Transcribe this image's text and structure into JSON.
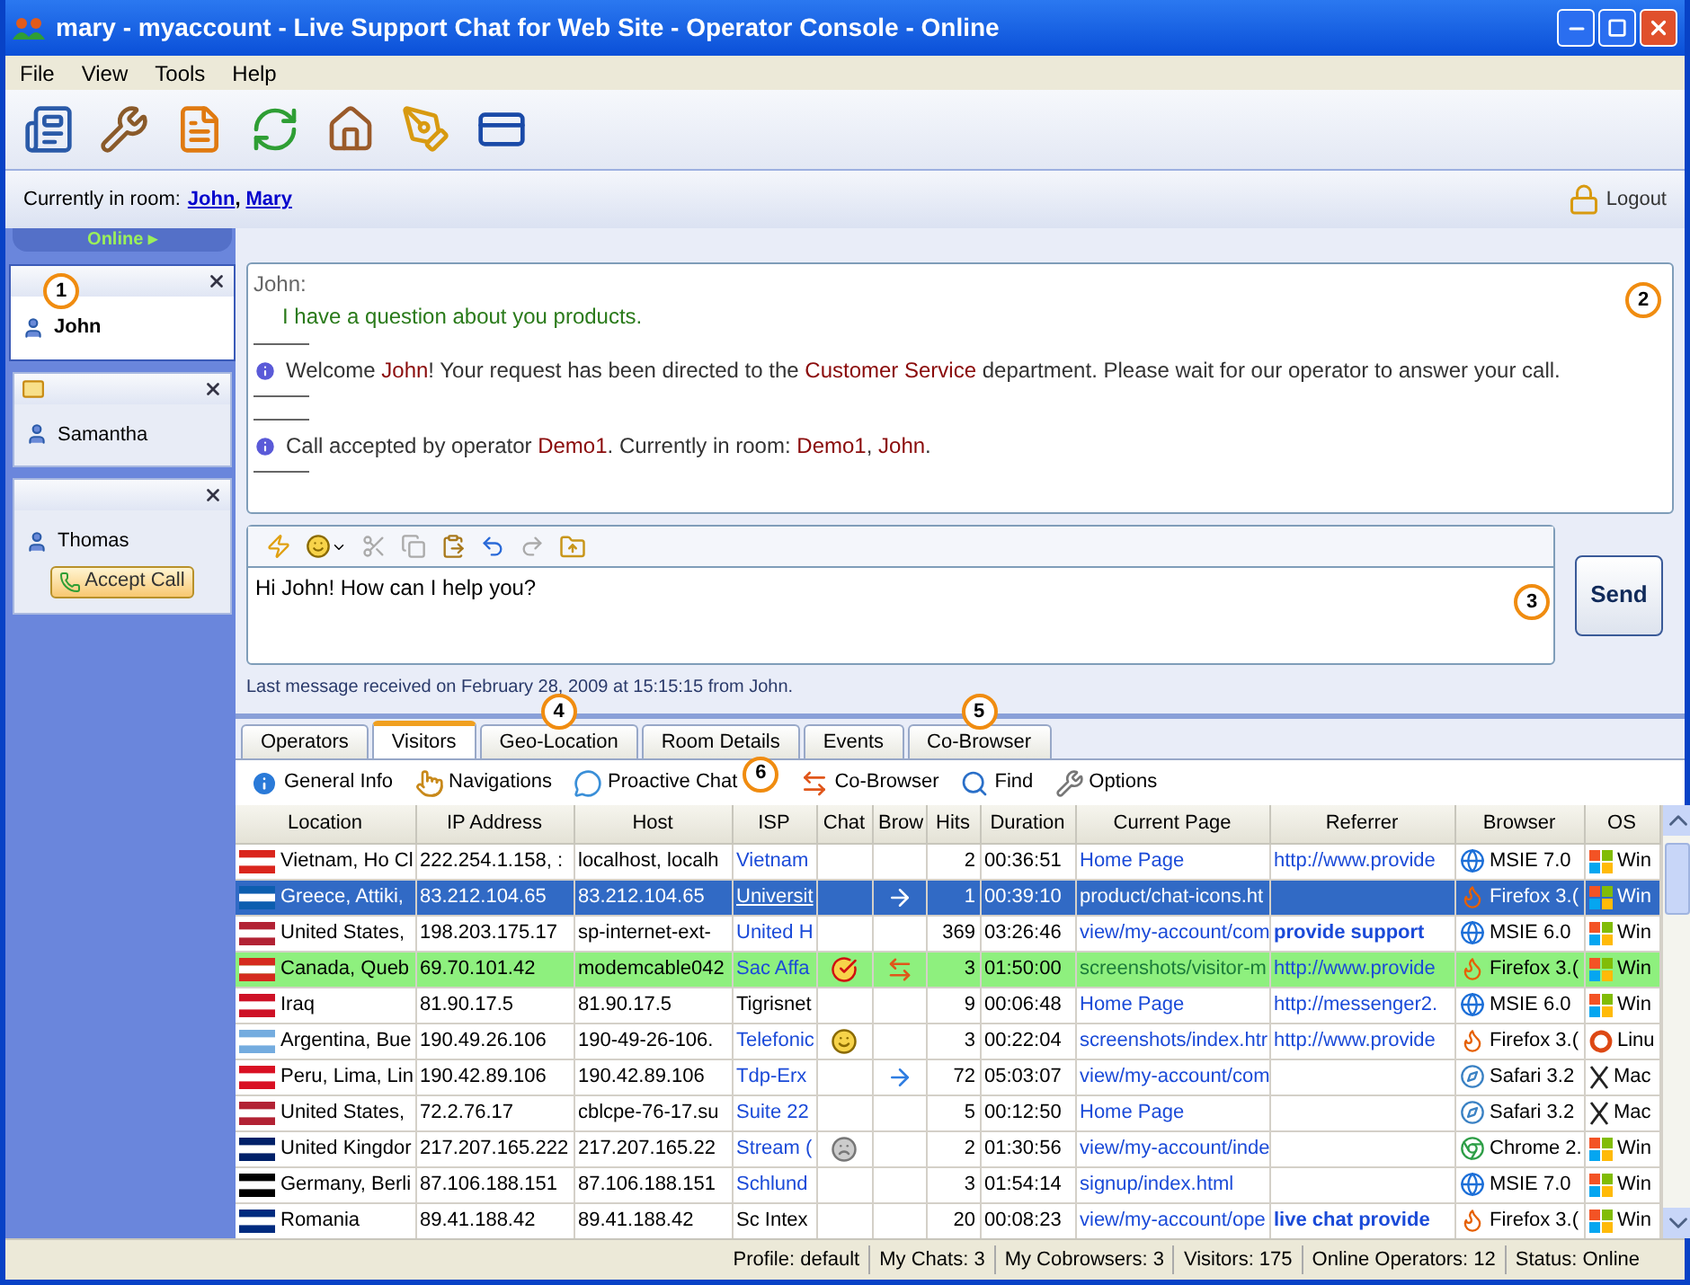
{
  "window": {
    "title": "mary - myaccount - Live Support Chat for Web Site - Operator Console - Online"
  },
  "menu": [
    "File",
    "View",
    "Tools",
    "Help"
  ],
  "room": {
    "label": "Currently in room:",
    "members": [
      "John",
      "Mary"
    ],
    "separator": ",",
    "logout": "Logout"
  },
  "status_tab": "Online ▸",
  "sessions": [
    {
      "name": "John",
      "selected": true,
      "unread": false,
      "marker": "1"
    },
    {
      "name": "Samantha",
      "selected": false,
      "unread": true
    },
    {
      "name": "Thomas",
      "selected": false,
      "unread": false,
      "action": "Accept Call"
    }
  ],
  "transcript": {
    "marker": "2",
    "messages": [
      {
        "kind": "chat",
        "author": "John:",
        "text": "I have a question about you products."
      },
      {
        "kind": "info",
        "parts": [
          {
            "text": "Welcome ",
            "highlight": false
          },
          {
            "text": "John",
            "highlight": true
          },
          {
            "text": "! Your request has been directed to the ",
            "highlight": false
          },
          {
            "text": "Customer Service",
            "highlight": true
          },
          {
            "text": " department.  Please wait for our operator to answer your call.",
            "highlight": false
          }
        ]
      },
      {
        "kind": "info",
        "parts": [
          {
            "text": "Call accepted by operator ",
            "highlight": false
          },
          {
            "text": "Demo1",
            "highlight": true
          },
          {
            "text": ". Currently in room: ",
            "highlight": false
          },
          {
            "text": "Demo1",
            "highlight": true
          },
          {
            "text": ", ",
            "highlight": false
          },
          {
            "text": "John",
            "highlight": true
          },
          {
            "text": ".",
            "highlight": false
          }
        ]
      }
    ]
  },
  "composer": {
    "value": "Hi John! How can I help you?",
    "marker": "3",
    "send": "Send"
  },
  "last_message": "Last message received on February 28, 2009 at 15:15:15 from John.",
  "tabs": [
    {
      "label": "Operators",
      "selected": false
    },
    {
      "label": "Visitors",
      "selected": true
    },
    {
      "label": "Geo-Location",
      "selected": false,
      "marker": "4"
    },
    {
      "label": "Room Details",
      "selected": false
    },
    {
      "label": "Events",
      "selected": false
    },
    {
      "label": "Co-Browser",
      "selected": false,
      "marker": "5"
    }
  ],
  "visitor_toolbar": [
    {
      "kind": "info",
      "label": "General Info"
    },
    {
      "kind": "hand",
      "label": "Navigations"
    },
    {
      "kind": "bubble",
      "label": "Proactive Chat",
      "marker": "6"
    },
    {
      "kind": "cobrowse",
      "label": "Co-Browser"
    },
    {
      "kind": "search",
      "label": "Find"
    },
    {
      "kind": "tools",
      "label": "Options"
    }
  ],
  "table": {
    "columns": [
      "Location",
      "IP Address",
      "Host",
      "ISP",
      "Chat",
      "Brow",
      "Hits",
      "Duration",
      "Current Page",
      "Referrer",
      "Browser",
      "OS"
    ],
    "rows": [
      {
        "selected": false,
        "in_chat": false,
        "color": "#da251d",
        "location": "Vietnam, Ho Cl",
        "ip": "222.254.1.158, :",
        "host": "localhost, localh",
        "isp": {
          "text": "Vietnam",
          "link": true
        },
        "hits": "2",
        "duration": "00:36:51",
        "page": "Home Page",
        "referrer": {
          "text": "http://www.provide",
          "kind": "url"
        },
        "browser": {
          "text": "MSIE 7.0",
          "kind": "ie"
        },
        "os": {
          "text": "Win",
          "kind": "windows"
        }
      },
      {
        "selected": true,
        "in_chat": false,
        "color": "#0d5eaf",
        "location": "Greece, Attiki,",
        "ip": "83.212.104.65",
        "host": "83.212.104.65",
        "isp": {
          "text": "Universit",
          "link": true
        },
        "brow": {
          "kind": "arrow"
        },
        "hits": "1",
        "duration": "00:39:10",
        "page": "product/chat-icons.ht",
        "browser": {
          "text": "Firefox 3.(",
          "kind": "firefox"
        },
        "os": {
          "text": "Win",
          "kind": "windows"
        }
      },
      {
        "selected": false,
        "in_chat": false,
        "color": "#b22234",
        "location": "United States,",
        "ip": "198.203.175.17",
        "host": "sp-internet-ext-",
        "isp": {
          "text": "United H",
          "link": true
        },
        "hits": "369",
        "duration": "03:26:46",
        "page": "view/my-account/com",
        "referrer": {
          "text": "provide support",
          "kind": "keyword"
        },
        "browser": {
          "text": "MSIE 6.0",
          "kind": "ie"
        },
        "os": {
          "text": "Win",
          "kind": "windows"
        }
      },
      {
        "selected": false,
        "in_chat": true,
        "color": "#d52b1e",
        "location": "Canada, Queb",
        "ip": "69.70.101.42",
        "host": "modemcable042",
        "isp": {
          "text": "Sac Affa",
          "link": true
        },
        "chat": {
          "kind": "accepted"
        },
        "brow": {
          "kind": "cobrowse"
        },
        "hits": "3",
        "duration": "01:50:00",
        "page": "screenshots/visitor-m",
        "referrer": {
          "text": "http://www.provide",
          "kind": "url"
        },
        "browser": {
          "text": "Firefox 3.(",
          "kind": "firefox"
        },
        "os": {
          "text": "Win",
          "kind": "windows"
        }
      },
      {
        "selected": false,
        "in_chat": false,
        "color": "#ce1126",
        "location": "Iraq",
        "ip": "81.90.17.5",
        "host": "81.90.17.5",
        "isp": {
          "text": "Tigrisnet",
          "link": false
        },
        "hits": "9",
        "duration": "00:06:48",
        "page": "Home Page",
        "referrer": {
          "text": "http://messenger2.",
          "kind": "url"
        },
        "browser": {
          "text": "MSIE 6.0",
          "kind": "ie"
        },
        "os": {
          "text": "Win",
          "kind": "windows"
        }
      },
      {
        "selected": false,
        "in_chat": false,
        "color": "#74acdf",
        "location": "Argentina, Bue",
        "ip": "190.49.26.106",
        "host": "190-49-26-106.",
        "isp": {
          "text": "Telefonic",
          "link": true
        },
        "chat": {
          "kind": "smiley"
        },
        "hits": "3",
        "duration": "00:22:04",
        "page": "screenshots/index.htr",
        "referrer": {
          "text": "http://www.provide",
          "kind": "url"
        },
        "browser": {
          "text": "Firefox 3.(",
          "kind": "firefox"
        },
        "os": {
          "text": "Linu",
          "kind": "linux"
        }
      },
      {
        "selected": false,
        "in_chat": false,
        "color": "#d91023",
        "location": "Peru, Lima, Lin",
        "ip": "190.42.89.106",
        "host": "190.42.89.106",
        "isp": {
          "text": "Tdp-Erx",
          "link": true
        },
        "brow": {
          "kind": "arrow"
        },
        "hits": "72",
        "duration": "05:03:07",
        "page": "view/my-account/com",
        "browser": {
          "text": "Safari 3.2",
          "kind": "safari"
        },
        "os": {
          "text": "Mac",
          "kind": "mac"
        }
      },
      {
        "selected": false,
        "in_chat": false,
        "color": "#b22234",
        "location": "United States,",
        "ip": "72.2.76.17",
        "host": "cblcpe-76-17.su",
        "isp": {
          "text": "Suite 22",
          "link": true
        },
        "hits": "5",
        "duration": "00:12:50",
        "page": "Home Page",
        "browser": {
          "text": "Safari 3.2",
          "kind": "safari"
        },
        "os": {
          "text": "Mac",
          "kind": "mac"
        }
      },
      {
        "selected": false,
        "in_chat": false,
        "color": "#012169",
        "location": "United Kingdor",
        "ip": "217.207.165.222",
        "host": "217.207.165.22",
        "isp": {
          "text": "Stream (",
          "link": true
        },
        "chat": {
          "kind": "idle"
        },
        "hits": "2",
        "duration": "01:30:56",
        "page": "view/my-account/inde",
        "browser": {
          "text": "Chrome 2.",
          "kind": "chrome"
        },
        "os": {
          "text": "Win",
          "kind": "windows"
        }
      },
      {
        "selected": false,
        "in_chat": false,
        "color": "#000000",
        "location": "Germany, Berli",
        "ip": "87.106.188.151",
        "host": "87.106.188.151",
        "isp": {
          "text": "Schlund",
          "link": true
        },
        "hits": "3",
        "duration": "01:54:14",
        "page": "signup/index.html",
        "browser": {
          "text": "MSIE 7.0",
          "kind": "ie"
        },
        "os": {
          "text": "Win",
          "kind": "windows"
        }
      },
      {
        "selected": false,
        "in_chat": false,
        "color": "#002b7f",
        "location": "Romania",
        "ip": "89.41.188.42",
        "host": "89.41.188.42",
        "isp": {
          "text": "Sc Intex",
          "link": false
        },
        "hits": "20",
        "duration": "00:08:23",
        "page": "view/my-account/ope",
        "referrer": {
          "text": "live chat provide",
          "kind": "keyword"
        },
        "browser": {
          "text": "Firefox 3.(",
          "kind": "firefox"
        },
        "os": {
          "text": "Win",
          "kind": "windows"
        }
      }
    ]
  },
  "status_bar": [
    "Profile: default",
    "My Chats: 3",
    "My Cobrowsers: 3",
    "Visitors: 175",
    "Online Operators: 12",
    "Status: Online"
  ]
}
